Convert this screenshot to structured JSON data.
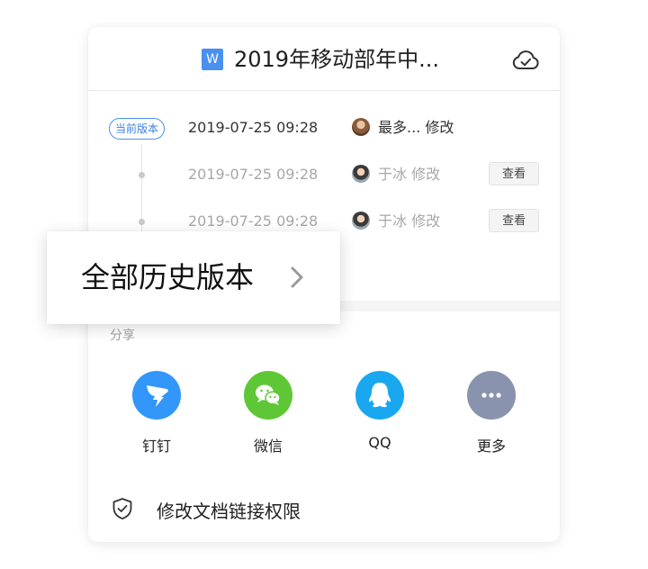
{
  "header": {
    "doc_icon_letter": "W",
    "title": "2019年移动部年中...",
    "cloud_icon": "cloud-check-icon"
  },
  "versions": [
    {
      "tag": "当前版本",
      "time": "2019-07-25 09:28",
      "editor": "最多... 修改",
      "current": true
    },
    {
      "time": "2019-07-25 09:28",
      "editor": "于冰 修改",
      "action": "查看",
      "current": false
    },
    {
      "time": "2019-07-25 09:28",
      "editor": "于冰 修改",
      "action": "查看",
      "current": false
    }
  ],
  "history": {
    "label": "全部历史版本",
    "chevron_icon": "chevron-right-icon"
  },
  "share": {
    "label": "分享",
    "items": [
      {
        "label": "钉钉",
        "icon": "dingtalk-icon",
        "color": "#3296fa"
      },
      {
        "label": "微信",
        "icon": "wechat-icon",
        "color": "#5ec736"
      },
      {
        "label": "QQ",
        "icon": "qq-icon",
        "color": "#19a8f0"
      },
      {
        "label": "更多",
        "icon": "more-icon",
        "color": "#8a93ad"
      }
    ]
  },
  "permission": {
    "label": "修改文档链接权限",
    "icon": "shield-check-icon"
  }
}
